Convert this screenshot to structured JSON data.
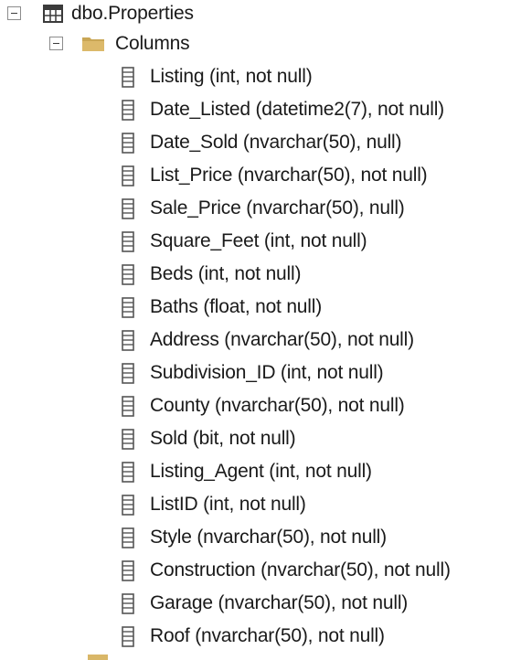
{
  "tree": {
    "table": {
      "label": "dbo.Properties",
      "icon": "table-icon"
    },
    "columns_folder": {
      "label": "Columns",
      "icon": "folder-icon"
    },
    "columns": [
      {
        "label": "Listing (int, not null)"
      },
      {
        "label": "Date_Listed (datetime2(7), not null)"
      },
      {
        "label": "Date_Sold (nvarchar(50), null)"
      },
      {
        "label": "List_Price (nvarchar(50), not null)"
      },
      {
        "label": "Sale_Price (nvarchar(50), null)"
      },
      {
        "label": "Square_Feet (int, not null)"
      },
      {
        "label": "Beds (int, not null)"
      },
      {
        "label": "Baths (float, not null)"
      },
      {
        "label": "Address (nvarchar(50), not null)"
      },
      {
        "label": "Subdivision_ID (int, not null)"
      },
      {
        "label": "County (nvarchar(50), not null)"
      },
      {
        "label": "Sold (bit, not null)"
      },
      {
        "label": "Listing_Agent (int, not null)"
      },
      {
        "label": "ListID (int, not null)"
      },
      {
        "label": "Style (nvarchar(50), not null)"
      },
      {
        "label": "Construction (nvarchar(50), not null)"
      },
      {
        "label": "Garage (nvarchar(50), not null)"
      },
      {
        "label": "Roof (nvarchar(50), not null)"
      }
    ],
    "colors": {
      "folder": "#dcb96a",
      "table_icon": "#3b3b3b",
      "column_icon": "#555555",
      "expander_border": "#8c8c8c"
    }
  }
}
